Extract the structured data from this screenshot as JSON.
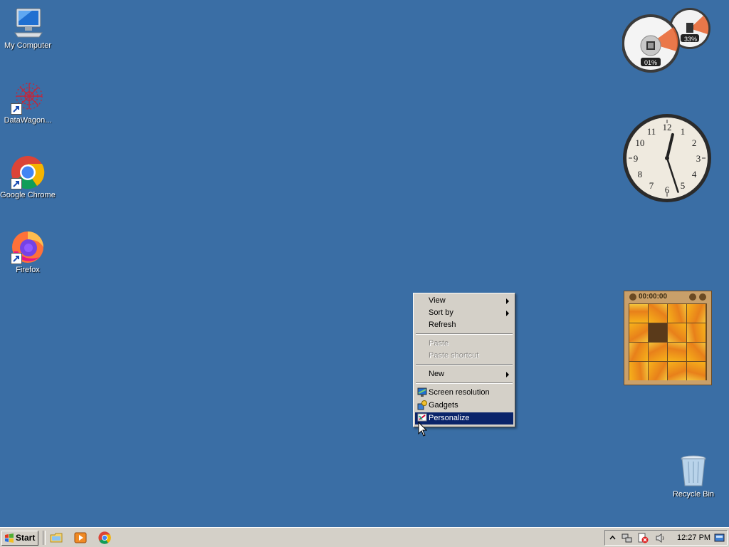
{
  "desktop": {
    "icons": [
      {
        "label": "My Computer",
        "icon": "computer-icon"
      },
      {
        "label": "DataWagon...",
        "icon": "datawagon-icon"
      },
      {
        "label": "Google Chrome",
        "icon": "chrome-icon"
      },
      {
        "label": "Firefox",
        "icon": "firefox-icon"
      },
      {
        "label": "Recycle Bin",
        "icon": "recycle-bin-icon"
      }
    ]
  },
  "gadgets": {
    "cpu_meter": {
      "cpu_percent": "01%",
      "memory_percent": "33%",
      "cpu_value": 1,
      "memory_value": 33
    },
    "clock": {
      "numerals": [
        "12",
        "1",
        "2",
        "3",
        "4",
        "5",
        "6",
        "7",
        "8",
        "9",
        "10",
        "11"
      ],
      "hour": 12,
      "minute": 27
    },
    "puzzle": {
      "timer": "00:00:00"
    }
  },
  "context_menu": {
    "items": [
      {
        "label": "View",
        "submenu": true,
        "enabled": true
      },
      {
        "label": "Sort by",
        "submenu": true,
        "enabled": true
      },
      {
        "label": "Refresh",
        "enabled": true
      },
      {
        "label": "Paste",
        "enabled": false
      },
      {
        "label": "Paste shortcut",
        "enabled": false
      },
      {
        "label": "New",
        "submenu": true,
        "enabled": true
      },
      {
        "label": "Screen resolution",
        "enabled": true,
        "icon": "monitor-icon"
      },
      {
        "label": "Gadgets",
        "enabled": true,
        "icon": "gadgets-icon"
      },
      {
        "label": "Personalize",
        "enabled": true,
        "icon": "personalize-icon",
        "highlighted": true
      }
    ]
  },
  "taskbar": {
    "start_label": "Start",
    "quick_launch": [
      "file-explorer-icon",
      "media-player-icon",
      "chrome-icon"
    ],
    "tray_icons": [
      "show-hidden-icons-icon",
      "network-icon",
      "security-alert-icon",
      "volume-icon",
      "action-center-icon"
    ],
    "clock": "12:27 PM"
  },
  "colors": {
    "desktop": "#3a6ea5",
    "menu_highlight": "#0a246a",
    "taskbar": "#d4d0c8"
  }
}
